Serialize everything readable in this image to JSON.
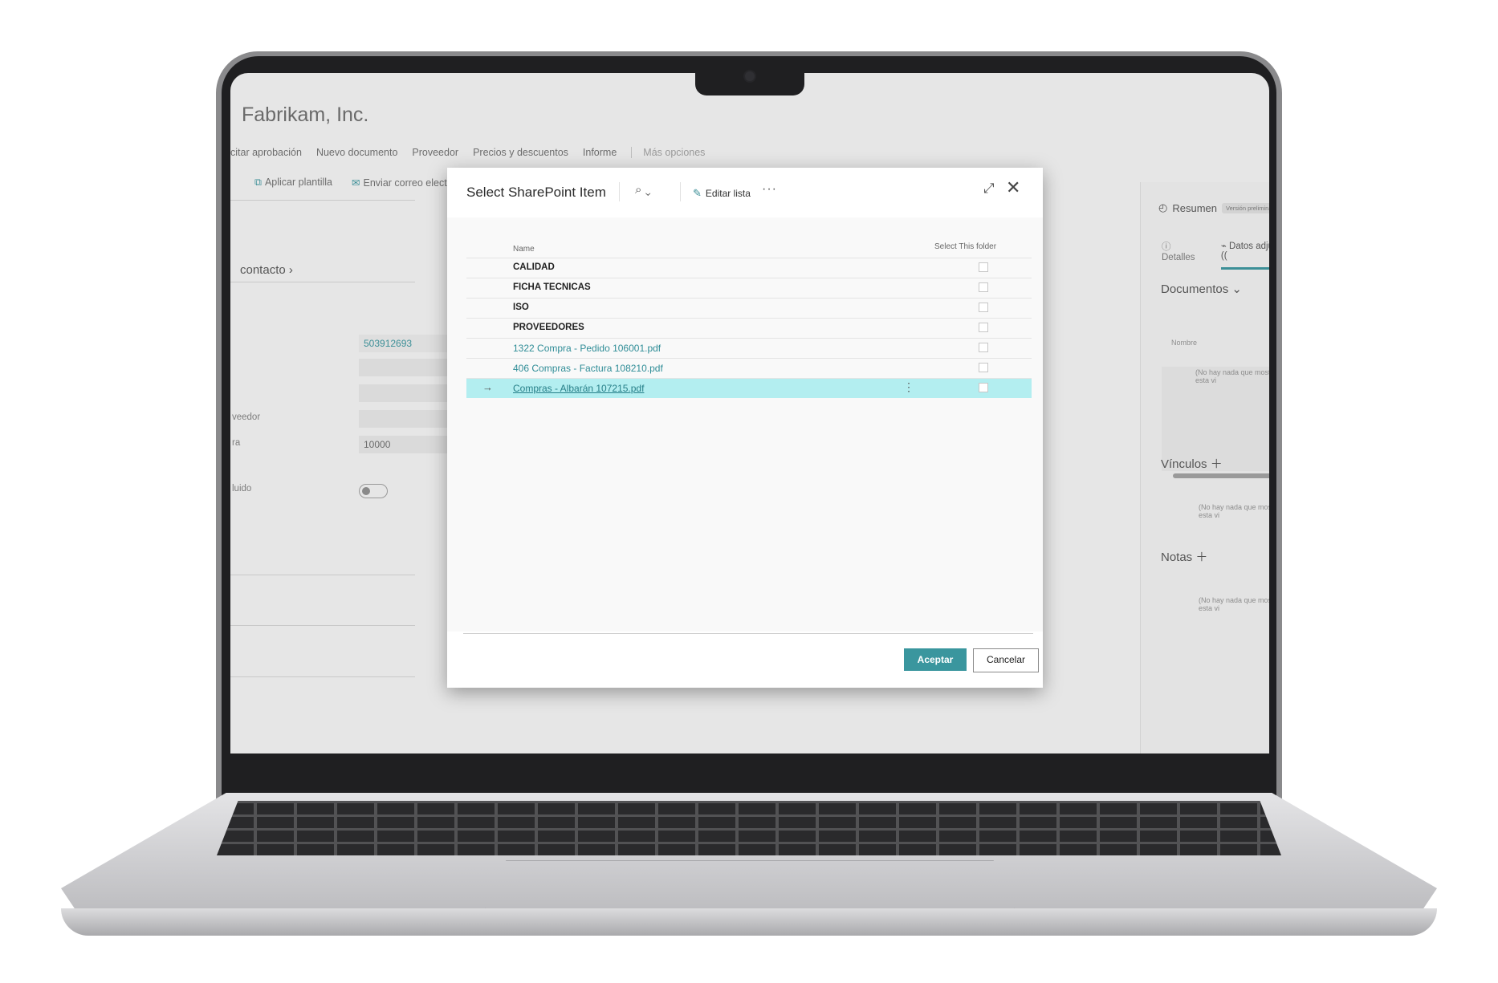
{
  "background_page": {
    "title": "Fabrikam, Inc.",
    "actions": [
      "citar aprobación",
      "Nuevo documento",
      "Proveedor",
      "Precios y descuentos",
      "Informe"
    ],
    "more_actions": "Más opciones",
    "toolbar": [
      "Aplicar plantilla",
      "Enviar correo electr"
    ],
    "section": "contacto",
    "fields": {
      "vat": "503912693",
      "supplier_label": "veedor",
      "amount_label": "ra",
      "amount": "10000",
      "toggle_label": "luido"
    }
  },
  "factbox": {
    "title": "Resumen",
    "badge": "Versión preliminar",
    "tabs": [
      "Detalles",
      "Datos adjuntos (("
    ],
    "documents": "Documentos",
    "name_col": "Nombre",
    "empty1": "(No hay nada que mostrar en esta vi",
    "links": "Vínculos",
    "empty2": "(No hay nada que mostrar en esta vi",
    "notes": "Notas",
    "empty3": "(No hay nada que mostrar en esta vi"
  },
  "dialog": {
    "title": "Select SharePoint Item",
    "edit_list": "Editar lista",
    "more": "···",
    "columns": {
      "name": "Name",
      "select": "Select This folder"
    },
    "rows": [
      {
        "name": "CALIDAD",
        "type": "folder"
      },
      {
        "name": "FICHA TECNICAS",
        "type": "folder"
      },
      {
        "name": "ISO",
        "type": "folder"
      },
      {
        "name": "PROVEEDORES",
        "type": "folder"
      },
      {
        "name": "1322 Compra - Pedido 106001.pdf",
        "type": "file"
      },
      {
        "name": "406 Compras - Factura 108210.pdf",
        "type": "file"
      },
      {
        "name": "Compras - Albarán 107215.pdf",
        "type": "file",
        "selected": true
      }
    ],
    "ok_label": "Aceptar",
    "cancel_label": "Cancelar"
  },
  "colors": {
    "accent": "#3a969e",
    "selected_row": "#b3eef0"
  }
}
